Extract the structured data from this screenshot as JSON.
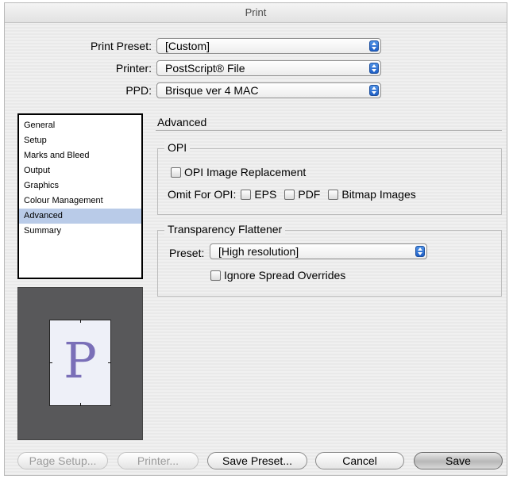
{
  "window": {
    "title": "Print"
  },
  "top_fields": {
    "print_preset": {
      "label": "Print Preset:",
      "value": "[Custom]"
    },
    "printer": {
      "label": "Printer:",
      "value": "PostScript® File"
    },
    "ppd": {
      "label": "PPD:",
      "value": "Brisque ver 4 MAC"
    }
  },
  "sidebar": {
    "items": [
      {
        "label": "General"
      },
      {
        "label": "Setup"
      },
      {
        "label": "Marks and Bleed"
      },
      {
        "label": "Output"
      },
      {
        "label": "Graphics"
      },
      {
        "label": "Colour Management"
      },
      {
        "label": "Advanced",
        "selected": true
      },
      {
        "label": "Summary"
      }
    ]
  },
  "preview": {
    "letter": "P"
  },
  "main": {
    "section_title": "Advanced",
    "opi": {
      "title": "OPI",
      "image_replacement": {
        "label": "OPI Image Replacement",
        "checked": false
      },
      "omit_label": "Omit For OPI:",
      "eps": {
        "label": "EPS",
        "checked": false
      },
      "pdf": {
        "label": "PDF",
        "checked": false
      },
      "bitmap": {
        "label": "Bitmap Images",
        "checked": false
      }
    },
    "transparency": {
      "title": "Transparency Flattener",
      "preset_label": "Preset:",
      "preset_value": "[High resolution]",
      "ignore_overrides": {
        "label": "Ignore Spread Overrides",
        "checked": false
      }
    }
  },
  "buttons": {
    "page_setup": "Page Setup...",
    "printer": "Printer...",
    "save_preset": "Save Preset...",
    "cancel": "Cancel",
    "save": "Save"
  }
}
